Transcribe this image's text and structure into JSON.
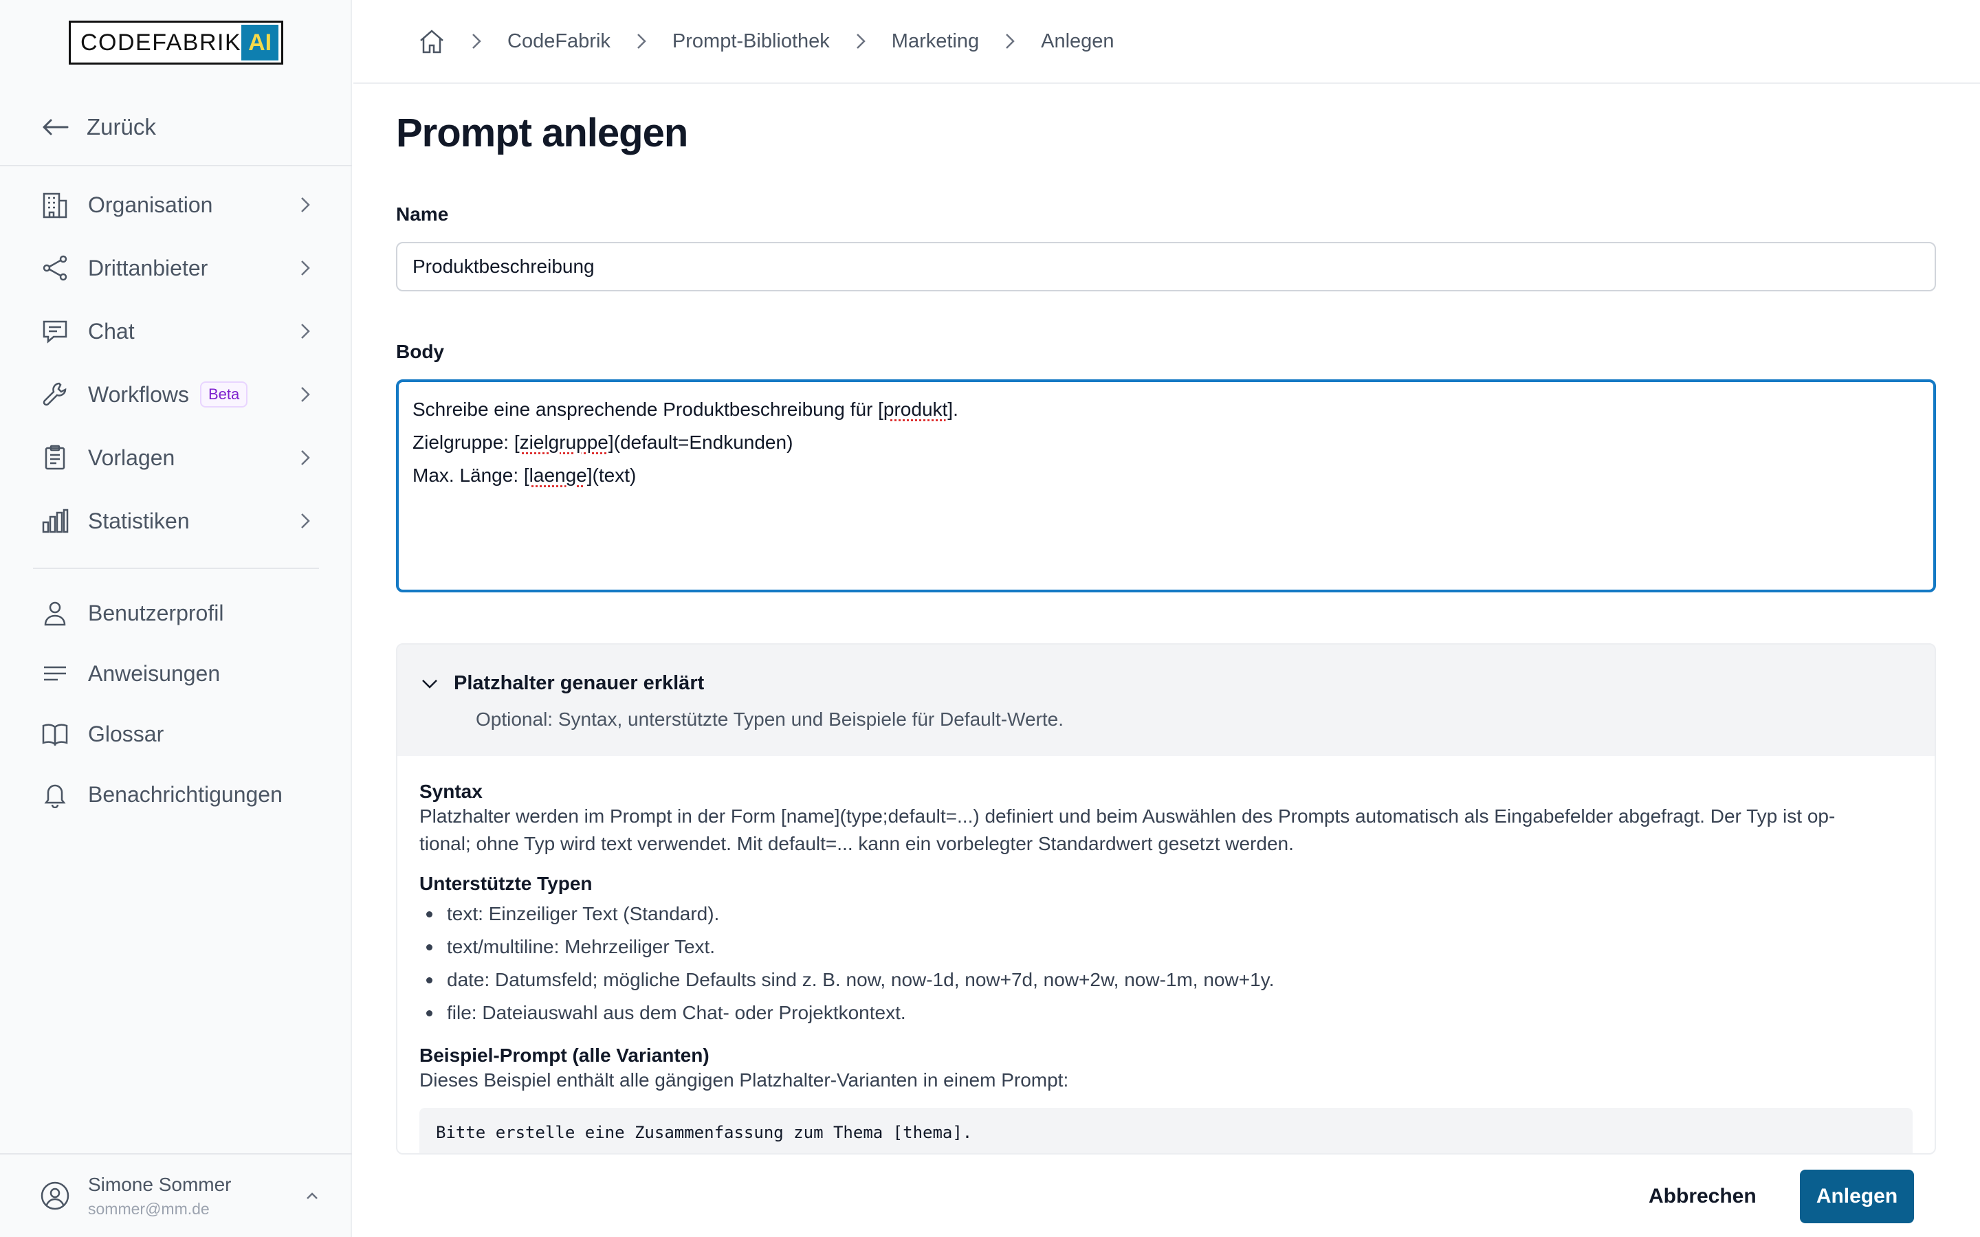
{
  "app": {
    "logo_text": "CODEFABRIK",
    "logo_badge": "AI"
  },
  "sidebar": {
    "back_label": "Zurück",
    "items": [
      {
        "label": "Organisation",
        "icon": "building-icon"
      },
      {
        "label": "Drittanbieter",
        "icon": "share-icon"
      },
      {
        "label": "Chat",
        "icon": "chat-icon"
      },
      {
        "label": "Workflows",
        "icon": "wrench-icon",
        "badge": "Beta"
      },
      {
        "label": "Vorlagen",
        "icon": "clipboard-icon"
      },
      {
        "label": "Statistiken",
        "icon": "bar-chart-icon"
      }
    ],
    "secondary": [
      {
        "label": "Benutzerprofil",
        "icon": "user-icon"
      },
      {
        "label": "Anweisungen",
        "icon": "lines-icon"
      },
      {
        "label": "Glossar",
        "icon": "book-icon"
      },
      {
        "label": "Benachrichtigungen",
        "icon": "bell-icon"
      }
    ],
    "user": {
      "name": "Simone Sommer",
      "email": "sommer@mm.de"
    }
  },
  "breadcrumb": [
    "CodeFabrik",
    "Prompt-Bibliothek",
    "Marketing",
    "Anlegen"
  ],
  "page": {
    "title": "Prompt anlegen",
    "name_label": "Name",
    "name_value": "Produktbeschreibung",
    "body_label": "Body",
    "body_lines": {
      "l1_pre": "Schreibe eine ansprechende Produktbeschreibung für ",
      "l1_ph": "[produkt]",
      "l1_post": ".",
      "l2_pre": "Zielgruppe: ",
      "l2_ph": "[zielgruppe]",
      "l2_post": "(default=Endkunden)",
      "l3_pre": "Max. Länge: ",
      "l3_ph": "[laenge]",
      "l3_post": "(text)"
    }
  },
  "help_panel": {
    "title": "Platzhalter genauer erklärt",
    "subtitle": "Optional: Syntax, unterstützte Typen und Beispiele für Default-Werte.",
    "syntax_heading": "Syntax",
    "syntax_text_1": "Platzhalter werden im Prompt in der Form [name](type;default=...) definiert und beim Auswählen des Prompts automatisch als Eingabefelder abgefragt. Der Typ ist op-",
    "syntax_text_2": "tional; ohne Typ wird text verwendet. Mit default=... kann ein vorbelegter Standardwert gesetzt werden.",
    "types_heading": "Unterstützte Typen",
    "types": [
      "text: Einzeiliger Text (Standard).",
      "text/multiline: Mehrzeiliger Text.",
      "date: Datumsfeld; mögliche Defaults sind z. B. now, now-1d, now+7d, now+2w, now-1m, now+1y.",
      "file: Dateiauswahl aus dem Chat- oder Projektkontext."
    ],
    "example_heading": "Beispiel-Prompt (alle Varianten)",
    "example_text": "Dieses Beispiel enthält alle gängigen Platzhalter-Varianten in einem Prompt:",
    "example_code": "Bitte erstelle eine Zusammenfassung zum Thema [thema]."
  },
  "footer": {
    "cancel_label": "Abbrechen",
    "create_label": "Anlegen"
  },
  "colors": {
    "primary": "#0a5f8f",
    "focus": "#1479c4",
    "beta": "#7e22ce"
  }
}
